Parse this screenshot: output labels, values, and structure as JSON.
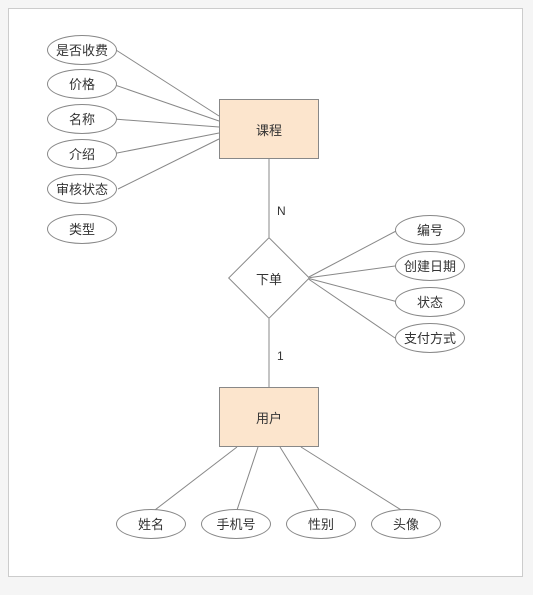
{
  "diagram": {
    "type": "ER",
    "entities": {
      "course": {
        "label": "课程"
      },
      "user": {
        "label": "用户"
      }
    },
    "relationship": {
      "order": {
        "label": "下单"
      }
    },
    "cardinality": {
      "course_side": "N",
      "user_side": "1"
    },
    "attributes": {
      "course": {
        "is_charged": "是否收费",
        "price": "价格",
        "name": "名称",
        "intro": "介绍",
        "audit_status": "审核状态",
        "type": "类型"
      },
      "order": {
        "id": "编号",
        "created_date": "创建日期",
        "status": "状态",
        "pay_method": "支付方式"
      },
      "user": {
        "name": "姓名",
        "phone": "手机号",
        "gender": "性别",
        "avatar": "头像"
      }
    }
  }
}
